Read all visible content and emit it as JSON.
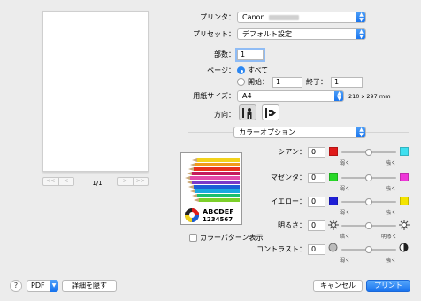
{
  "pager": {
    "first": "<<",
    "prev": "<",
    "page": "1/1",
    "next": ">",
    "last": ">>"
  },
  "printer": {
    "label": "プリンタ：",
    "value": "Canon"
  },
  "preset": {
    "label": "プリセット：",
    "value": "デフォルト設定"
  },
  "copies": {
    "label": "部数：",
    "value": "1"
  },
  "pages": {
    "label": "ページ：",
    "all": "すべて",
    "from_label": "開始：",
    "from": "1",
    "to_label": "終了：",
    "to": "1"
  },
  "paper": {
    "label": "用紙サイズ：",
    "value": "A4",
    "dims": "210 x 297 mm"
  },
  "orientation": {
    "label": "方向："
  },
  "section": {
    "value": "カラーオプション"
  },
  "preview_sample": {
    "text1": "ABCDEF",
    "text2": "1234567"
  },
  "color_pattern": {
    "label": "カラーパターン表示"
  },
  "adjust": [
    {
      "label": "シアン：",
      "value": "0",
      "low": "弱く",
      "high": "強く",
      "low_color": "#e01b1b",
      "high_color": "#3fe0f0"
    },
    {
      "label": "マゼンタ：",
      "value": "0",
      "low": "弱く",
      "high": "強く",
      "low_color": "#27d827",
      "high_color": "#ef37d9"
    },
    {
      "label": "イエロー：",
      "value": "0",
      "low": "弱く",
      "high": "強く",
      "low_color": "#1f1fd6",
      "high_color": "#f4e400"
    },
    {
      "label": "明るさ：",
      "value": "0",
      "low": "暗く",
      "high": "明るく",
      "low_color": "",
      "high_color": ""
    },
    {
      "label": "コントラスト：",
      "value": "0",
      "low": "弱く",
      "high": "強く",
      "low_color": "",
      "high_color": ""
    }
  ],
  "footer": {
    "help": "?",
    "pdf": "PDF",
    "hide_details": "詳細を隠す",
    "cancel": "キャンセル",
    "print": "プリント"
  },
  "colors": {
    "accent": "#1a74ef"
  }
}
